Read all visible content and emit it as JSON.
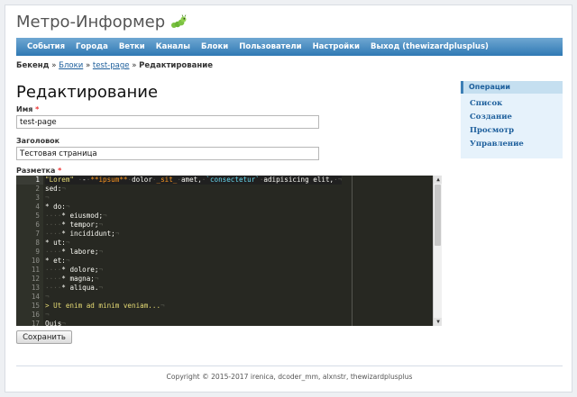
{
  "app": {
    "title": "Метро-Информер",
    "logo_icon": "green-caterpillar-icon"
  },
  "mainmenu": [
    "События",
    "Города",
    "Ветки",
    "Каналы",
    "Блоки",
    "Пользователи",
    "Настройки",
    "Выход (thewizardplusplus)"
  ],
  "breadcrumbs": {
    "root": "Бекенд",
    "sep": "»",
    "blocks": "Блоки",
    "page": "test-page",
    "current": "Редактирование"
  },
  "heading": "Редактирование",
  "form": {
    "name_label": "Имя",
    "name_value": "test-page",
    "title_label": "Заголовок",
    "title_value": "Тестовая страница",
    "markup_label": "Разметка",
    "required_mark": "*",
    "save_label": "Сохранить"
  },
  "editor": {
    "line_numbers": [
      "1",
      "2",
      "3",
      "4",
      "5",
      "6",
      "7",
      "8",
      "9",
      "10",
      "11",
      "12",
      "13",
      "14",
      "15",
      "16",
      "17"
    ],
    "active_line": 1
  },
  "sidebar": {
    "title": "Операции",
    "items": [
      "Список",
      "Создание",
      "Просмотр",
      "Управление"
    ]
  },
  "footer": {
    "copyright": "Copyright © 2015-2017 irenica, dcoder_mm, alxnstr, thewizardplusplus"
  },
  "colors": {
    "menu": "#2f79b4",
    "editor_bg": "#272822",
    "link": "#1d5f9c"
  }
}
